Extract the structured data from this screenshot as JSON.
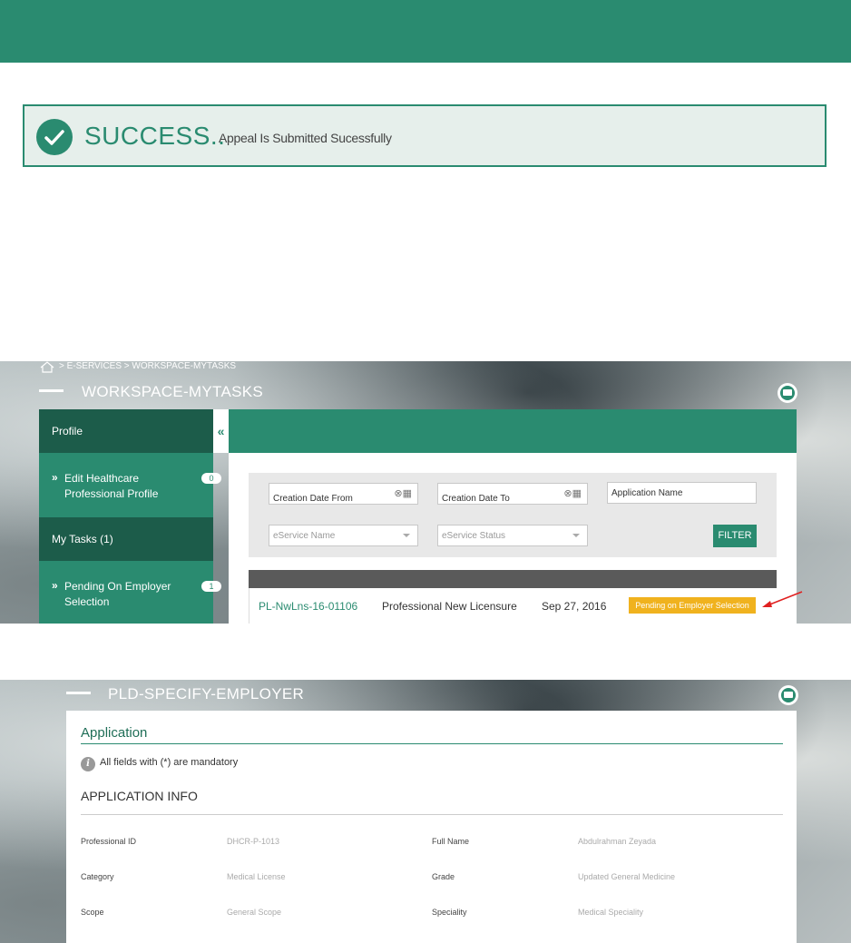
{
  "success": {
    "title": "SUCCESS..",
    "message": "Appeal Is Submitted Sucessfully"
  },
  "workspace": {
    "breadcrumb": "> E-SERVICES > WORKSPACE-MYTASKS",
    "title": "WORKSPACE-MYTASKS",
    "sidebar": {
      "profile": "Profile",
      "edit_profile_line1": "Edit Healthcare",
      "edit_profile_line2": "Professional Profile",
      "edit_profile_count": "0",
      "my_tasks": "My Tasks (1)",
      "pending_line1": "Pending On Employer",
      "pending_line2": "Selection",
      "pending_count": "1",
      "collapse": "«"
    },
    "filters": {
      "creation_date_from": "Creation Date From",
      "creation_date_to": "Creation Date To",
      "application_name": "Application Name",
      "eservice_name": "eService Name",
      "eservice_status": "eService Status",
      "filter_button": "FILTER"
    },
    "task_row": {
      "id": "PL-NwLns-16-01106",
      "service": "Professional New Licensure",
      "date": "Sep 27, 2016",
      "status": "Pending on Employer Selection"
    },
    "colors": {
      "primary": "#2a8b70",
      "dark": "#1c5c4a",
      "status": "#f0b21e"
    }
  },
  "pld": {
    "title": "PLD-SPECIFY-EMPLOYER",
    "section_title": "Application",
    "mandatory_note": "All fields with (*) are mandatory",
    "info_header": "APPLICATION INFO",
    "fields": [
      {
        "label": "Professional ID",
        "value": "DHCR-P-1013"
      },
      {
        "label": "Full Name",
        "value": "Abdulrahman Zeyada"
      },
      {
        "label": "Category",
        "value": "Medical License"
      },
      {
        "label": "Grade",
        "value": "Updated General Medicine"
      },
      {
        "label": "Scope",
        "value": "General Scope"
      },
      {
        "label": "Speciality",
        "value": "Medical Speciality"
      }
    ]
  }
}
